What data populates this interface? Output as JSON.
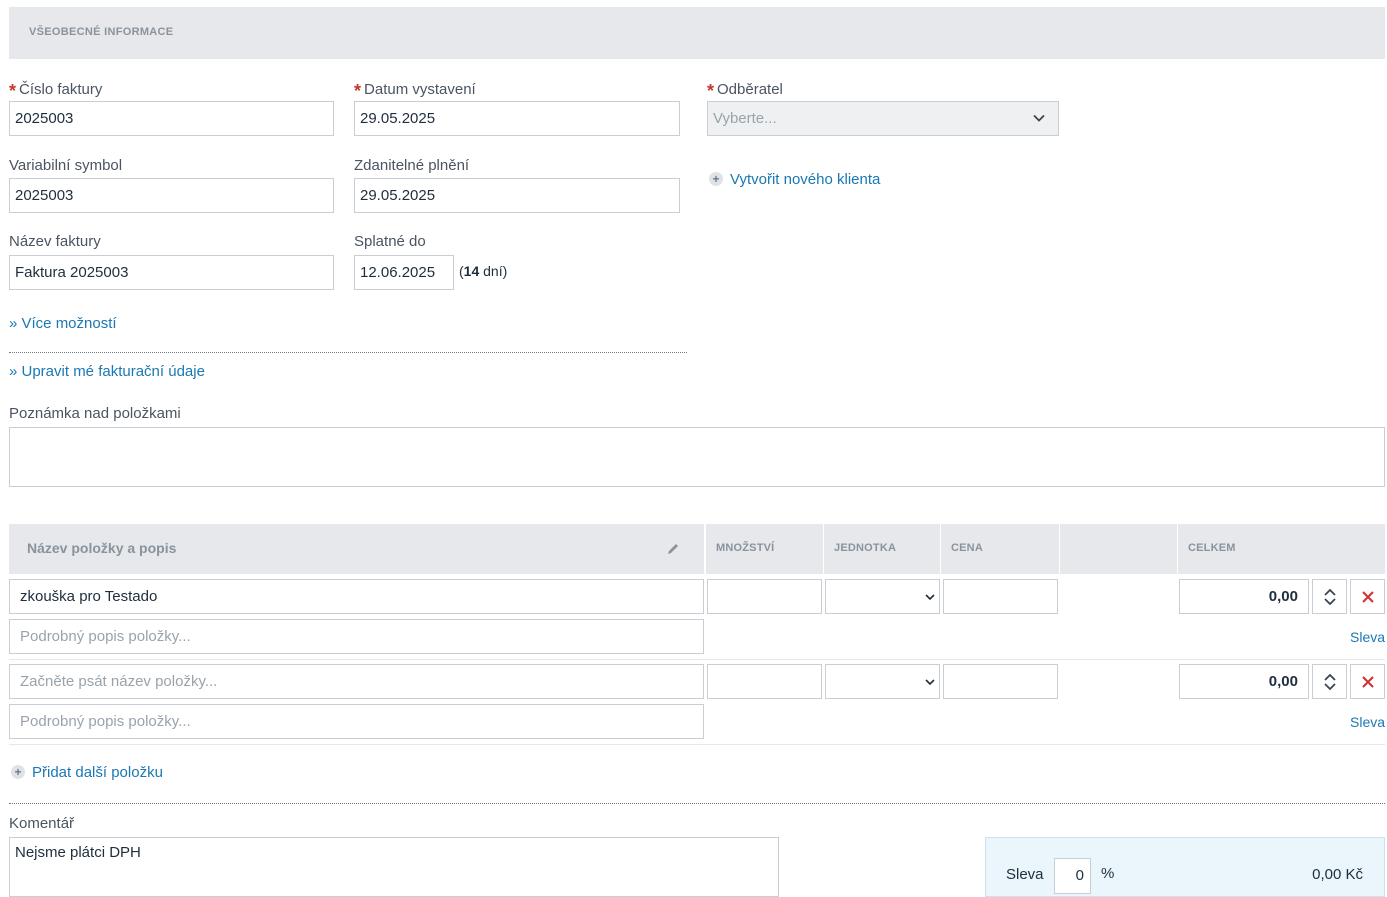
{
  "section": {
    "title": "VŠEOBECNÉ INFORMACE"
  },
  "form": {
    "invoice_number": {
      "label": "Číslo faktury",
      "value": "2025003"
    },
    "issue_date": {
      "label": "Datum vystavení",
      "value": "29.05.2025"
    },
    "customer": {
      "label": "Odběratel",
      "placeholder": "Vyberte..."
    },
    "variable_symbol": {
      "label": "Variabilní symbol",
      "value": "2025003"
    },
    "taxable_date": {
      "label": "Zdanitelné plnění",
      "value": "29.05.2025"
    },
    "create_client_label": "Vytvořit nového klienta",
    "invoice_name": {
      "label": "Název faktury",
      "value": "Faktura 2025003"
    },
    "due_date": {
      "label": "Splatné do",
      "value": "12.06.2025",
      "days_open": "(",
      "days": "14",
      "days_suffix": " dní)"
    },
    "more_options": "» Více možností",
    "edit_billing": "» Upravit mé fakturační údaje",
    "note_above": {
      "label": "Poznámka nad položkami",
      "value": ""
    }
  },
  "items_table": {
    "headers": {
      "name": "Název položky a popis",
      "quantity": "MNOŽSTVÍ",
      "unit": "JEDNOTKA",
      "price": "CENA",
      "total": "CELKEM"
    },
    "rows": [
      {
        "name": "zkouška pro Testado",
        "name_placeholder": "Začněte psát název položky...",
        "desc_placeholder": "Podrobný popis položky...",
        "total": "0,00",
        "discount": "Sleva"
      },
      {
        "name": "",
        "name_placeholder": "Začněte psát název položky...",
        "desc_placeholder": "Podrobný popis položky...",
        "total": "0,00",
        "discount": "Sleva"
      }
    ],
    "add_item": "Přidat další položku"
  },
  "comment": {
    "label": "Komentář",
    "value": "Nejsme plátci DPH"
  },
  "summary": {
    "discount_label": "Sleva",
    "discount_value": "0",
    "percent": "%",
    "amount": "0,00 Kč"
  },
  "colors": {
    "link": "#1a78b4",
    "required": "#c0392b",
    "delete": "#d0312d",
    "header_bg": "#e6e8eb",
    "summary_bg": "#eaf6fb"
  }
}
